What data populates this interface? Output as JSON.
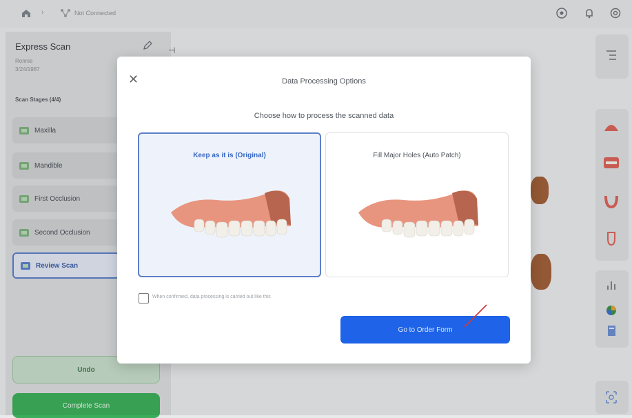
{
  "topbar": {
    "connection_status": "Not Connected",
    "separator": "›",
    "icons": [
      "home-icon",
      "network-icon",
      "help-icon",
      "bell-icon",
      "settings-icon"
    ]
  },
  "case": {
    "title": "Express Scan",
    "patient": "Ronnie",
    "date": "3/24/1987",
    "edit_icon": "pencil-icon",
    "toggle_label": "⊣"
  },
  "stages": {
    "heading": "Scan Stages (4/4)",
    "items": [
      {
        "label": "Maxilla",
        "active": false
      },
      {
        "label": "Mandible",
        "active": false
      },
      {
        "label": "First Occlusion",
        "active": false
      },
      {
        "label": "Second Occlusion",
        "active": false
      },
      {
        "label": "Review Scan",
        "active": true
      }
    ]
  },
  "buttons": {
    "undo": "Undo",
    "complete": "Complete Scan"
  },
  "right_toolbar": {
    "icons": [
      "list-icon",
      "upper-jaw-icon",
      "bite-icon",
      "lower-jaw-icon",
      "tooth-icon",
      "bar-chart-icon",
      "color-icon",
      "file-icon",
      "screenshot-icon"
    ]
  },
  "modal": {
    "title": "Data Processing Options",
    "subtitle": "Choose how to process the scanned data",
    "close_icon": "close-icon",
    "options": [
      {
        "label": "Keep as it is (Original)",
        "selected": true
      },
      {
        "label": "Fill Major Holes (Auto Patch)",
        "selected": false
      }
    ],
    "checkbox_label": "When confirmed, data processing is carried out like this",
    "checkbox_checked": false,
    "primary_button": "Go to Order Form"
  },
  "colors": {
    "accent": "#1e63e8",
    "selected_border": "#5c7fc9",
    "complete_green": "#3cae5a",
    "gum": "#e8957f",
    "tooth": "#f2efe9"
  }
}
